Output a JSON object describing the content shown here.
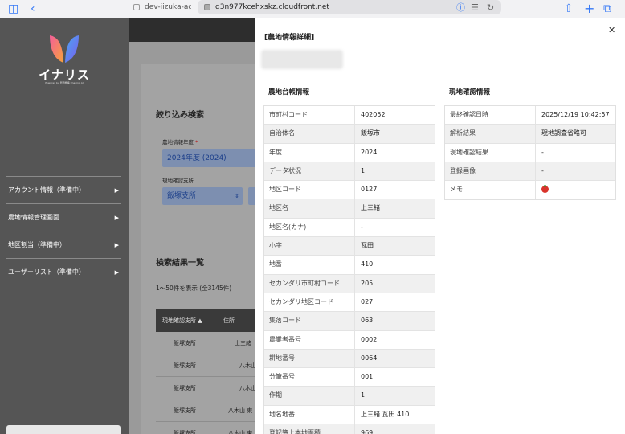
{
  "browser": {
    "tab_inactive": "dev-iizuka-agric",
    "tab_active": "d3n977kcehxskz.cloudfront.net"
  },
  "sidebar": {
    "logo_text": "イナリス",
    "logo_sub": "Powered by 農研機構 Imaging AI",
    "items": [
      {
        "label": "アカウント情報（準備中）"
      },
      {
        "label": "農地情報管理画面"
      },
      {
        "label": "地区割当（準備中）"
      },
      {
        "label": "ユーザーリスト（準備中）"
      }
    ]
  },
  "background": {
    "filter_title": "絞り込み検索",
    "year_label": "農地情報年度",
    "year_required": "*",
    "year_value": "2024年度 (2024)",
    "branch_label": "現地確認支所",
    "branch_value": "飯塚支所",
    "results_title": "検索結果一覧",
    "results_count": "1〜50件を表示 (全3145件)",
    "col_branch": "現地確認支所",
    "col_address": "住所",
    "rows": [
      {
        "branch": "飯塚支所",
        "address": "上三緒"
      },
      {
        "branch": "飯塚支所",
        "address": "八木山"
      },
      {
        "branch": "飯塚支所",
        "address": "八木山"
      },
      {
        "branch": "飯塚支所",
        "address": "八木山 東"
      },
      {
        "branch": "飯塚支所",
        "address": "八木山 東"
      }
    ]
  },
  "panel": {
    "title": "[農地情報詳細]",
    "ledger_title": "農地台帳情報",
    "ledger": [
      {
        "k": "市町村コード",
        "v": "402052"
      },
      {
        "k": "自治体名",
        "v": "飯塚市"
      },
      {
        "k": "年度",
        "v": "2024"
      },
      {
        "k": "データ状況",
        "v": "1"
      },
      {
        "k": "地区コード",
        "v": "0127"
      },
      {
        "k": "地区名",
        "v": "上三緒"
      },
      {
        "k": "地区名(カナ)",
        "v": "-"
      },
      {
        "k": "小字",
        "v": "瓦田"
      },
      {
        "k": "地番",
        "v": "410"
      },
      {
        "k": "セカンダリ市町村コード",
        "v": "205"
      },
      {
        "k": "セカンダリ地区コード",
        "v": "027"
      },
      {
        "k": "集落コード",
        "v": "063"
      },
      {
        "k": "農業者番号",
        "v": "0002"
      },
      {
        "k": "耕地番号",
        "v": "0064"
      },
      {
        "k": "分筆番号",
        "v": "001"
      },
      {
        "k": "作期",
        "v": "1"
      },
      {
        "k": "地名地番",
        "v": "上三緒 瓦田 410"
      },
      {
        "k": "登記簿上本地面積",
        "v": "969"
      }
    ],
    "site_title": "現地確認情報",
    "site": [
      {
        "k": "最終確認日時",
        "v": "2025/12/19 10:42:57"
      },
      {
        "k": "解析結果",
        "v": "現地調査省略可"
      },
      {
        "k": "現地確認結果",
        "v": "-"
      },
      {
        "k": "登録画像",
        "v": "-"
      },
      {
        "k": "メモ",
        "v": ""
      }
    ]
  }
}
